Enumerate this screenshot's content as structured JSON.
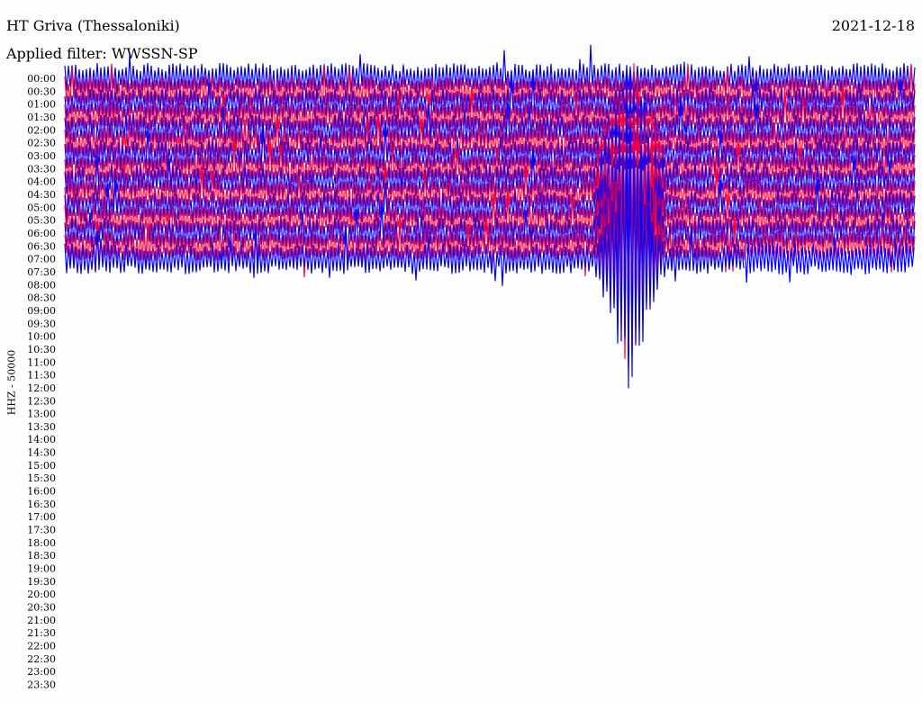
{
  "header": {
    "title": "HT Griva (Thessaloniki)",
    "date": "2021-12-18",
    "filter": "Applied filter: WWSSN-SP"
  },
  "chart_data": {
    "type": "line",
    "title": "HT Griva (Thessaloniki)",
    "subtitle": "Applied filter: WWSSN-SP",
    "ylabel": "HHZ - 50000",
    "tick_labels": [
      "00:00",
      "00:30",
      "01:00",
      "01:30",
      "02:00",
      "02:30",
      "03:00",
      "03:30",
      "04:00",
      "04:30",
      "05:00",
      "05:30",
      "06:00",
      "06:30",
      "07:00",
      "07:30",
      "08:00",
      "08:30",
      "09:00",
      "09:30",
      "10:00",
      "10:30",
      "11:00",
      "11:30",
      "12:00",
      "12:30",
      "13:00",
      "13:30",
      "14:00",
      "14:30",
      "15:00",
      "15:30",
      "16:00",
      "16:30",
      "17:00",
      "17:30",
      "18:00",
      "18:30",
      "19:00",
      "19:30",
      "20:00",
      "20:30",
      "21:00",
      "21:30",
      "22:00",
      "22:30",
      "23:00",
      "23:30"
    ],
    "rows_with_data": 15,
    "last_row_fraction": 0.8,
    "series_colors": [
      "#0000ff",
      "#ff0033"
    ],
    "background": "#fdfdfd",
    "event": {
      "row_start": 7,
      "x_fraction": 0.665,
      "description_note": ""
    },
    "grid": false
  }
}
